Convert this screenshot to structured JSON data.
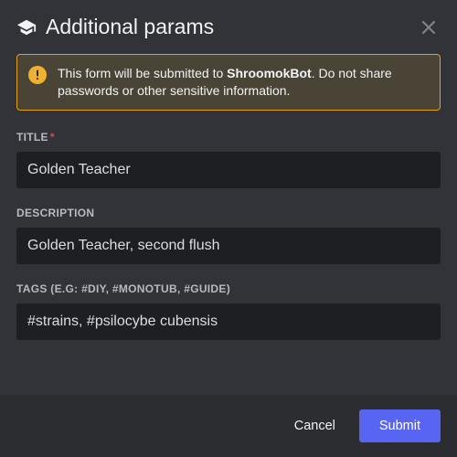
{
  "header": {
    "title": "Additional params"
  },
  "warning": {
    "text_prefix": "This form will be submitted to ",
    "bot_name": "ShroomokBot",
    "text_suffix": ". Do not share passwords or other sensitive information."
  },
  "fields": {
    "title": {
      "label": "Title",
      "value": "Golden Teacher",
      "required": true
    },
    "description": {
      "label": "Description",
      "value": "Golden Teacher, second flush"
    },
    "tags": {
      "label": "Tags (e.g: #diy, #monotub, #guide)",
      "value": "#strains, #psilocybe cubensis"
    }
  },
  "footer": {
    "cancel_label": "Cancel",
    "submit_label": "Submit"
  }
}
